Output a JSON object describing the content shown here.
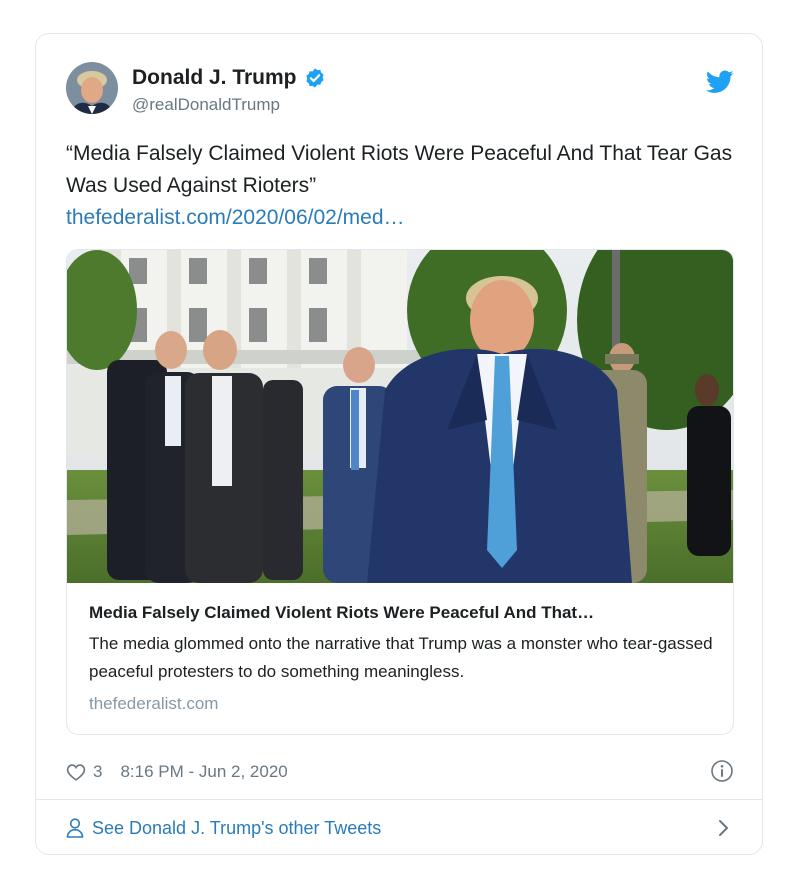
{
  "author": {
    "name": "Donald J. Trump",
    "handle": "@realDonaldTrump"
  },
  "tweet": {
    "text": "“Media Falsely Claimed Violent Riots Were Peaceful And That Tear Gas Was Used Against Rioters”",
    "link_text": "thefederalist.com/2020/06/02/med…"
  },
  "media_card": {
    "title": "Media Falsely Claimed Violent Riots Were Peaceful And That…",
    "description": "The media glommed onto the narrative that Trump was a monster who tear-gassed peaceful protesters to do something meaningless.",
    "domain": "thefederalist.com"
  },
  "meta": {
    "like_count": "3",
    "timestamp": "8:16 PM - Jun 2, 2020"
  },
  "footer": {
    "other_tweets_label": "See Donald J. Trump's other Tweets"
  },
  "colors": {
    "link": "#2b7bb9",
    "verified": "#1da1f2",
    "muted": "#697882",
    "border": "#e1e8ed"
  },
  "icons": [
    "verified-icon",
    "twitter-bird-icon",
    "heart-icon",
    "info-icon",
    "person-icon",
    "chevron-right-icon"
  ]
}
